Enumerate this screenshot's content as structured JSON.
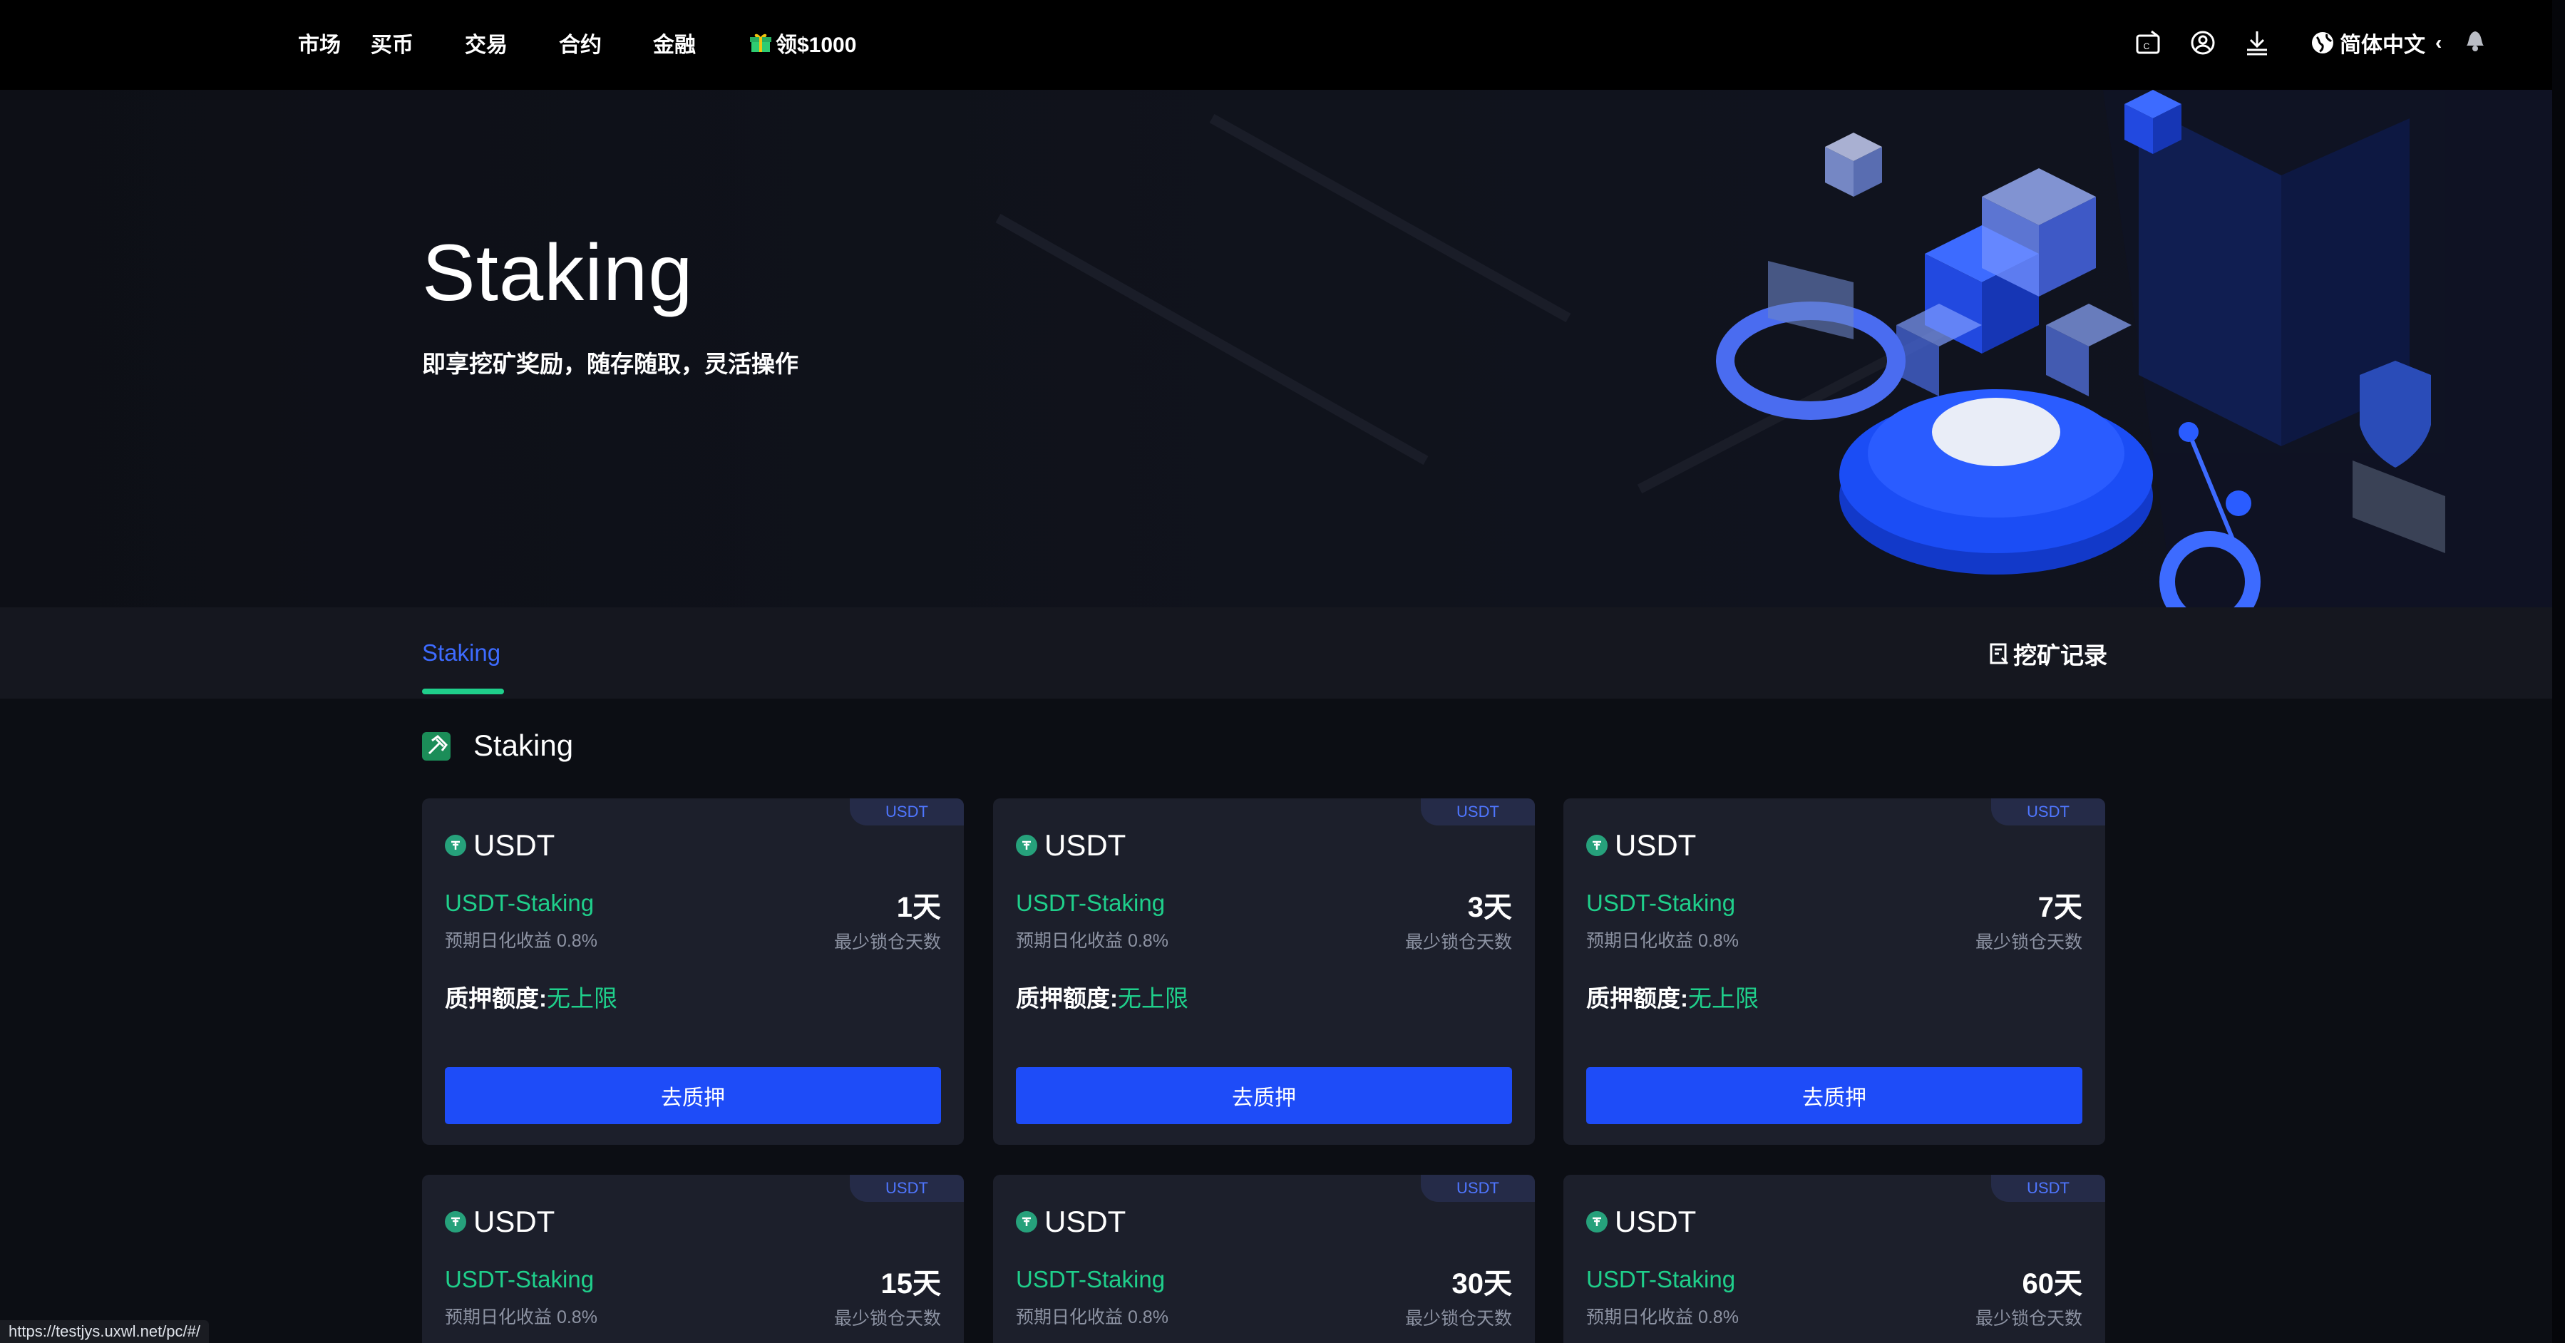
{
  "nav": {
    "items": [
      "市场",
      "买币",
      "交易",
      "合约",
      "金融"
    ],
    "promo": "领$1000",
    "language": "简体中文"
  },
  "hero": {
    "title": "Staking",
    "subtitle": "即享挖矿奖励，随存随取，灵活操作"
  },
  "tabs": {
    "active": "Staking",
    "record": "挖矿记录"
  },
  "section": {
    "title": "Staking"
  },
  "cards": [
    {
      "tag": "USDT",
      "coin": "USDT",
      "name": "USDT-Staking",
      "yield": "预期日化收益 0.8%",
      "days": "1天",
      "days_label": "最少锁仓天数",
      "limit_label": "质押额度:",
      "limit_value": "无上限",
      "button": "去质押"
    },
    {
      "tag": "USDT",
      "coin": "USDT",
      "name": "USDT-Staking",
      "yield": "预期日化收益 0.8%",
      "days": "3天",
      "days_label": "最少锁仓天数",
      "limit_label": "质押额度:",
      "limit_value": "无上限",
      "button": "去质押"
    },
    {
      "tag": "USDT",
      "coin": "USDT",
      "name": "USDT-Staking",
      "yield": "预期日化收益 0.8%",
      "days": "7天",
      "days_label": "最少锁仓天数",
      "limit_label": "质押额度:",
      "limit_value": "无上限",
      "button": "去质押"
    },
    {
      "tag": "USDT",
      "coin": "USDT",
      "name": "USDT-Staking",
      "yield": "预期日化收益 0.8%",
      "days": "15天",
      "days_label": "最少锁仓天数"
    },
    {
      "tag": "USDT",
      "coin": "USDT",
      "name": "USDT-Staking",
      "yield": "预期日化收益 0.8%",
      "days": "30天",
      "days_label": "最少锁仓天数"
    },
    {
      "tag": "USDT",
      "coin": "USDT",
      "name": "USDT-Staking",
      "yield": "预期日化收益 0.8%",
      "days": "60天",
      "days_label": "最少锁仓天数"
    }
  ],
  "status_url": "https://testjys.uxwl.net/pc/#/",
  "colors": {
    "accent": "#1e4cf8",
    "green": "#1fcf8b",
    "card": "#1c1f2b"
  }
}
